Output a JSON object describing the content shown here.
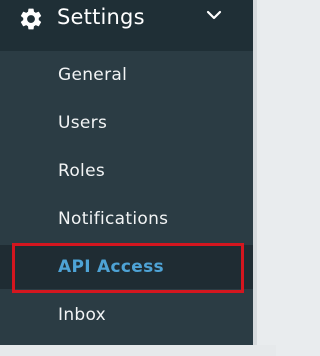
{
  "header": {
    "title": "Settings",
    "icon": "gear-icon",
    "toggle_icon": "chevron-down-icon"
  },
  "menu": {
    "items": [
      {
        "label": "General"
      },
      {
        "label": "Users"
      },
      {
        "label": "Roles"
      },
      {
        "label": "Notifications"
      },
      {
        "label": "API Access",
        "active": true
      },
      {
        "label": "Inbox"
      }
    ]
  },
  "colors": {
    "sidebar_bg": "#2b3c44",
    "header_bg": "#1f2f36",
    "active_text": "#4ea3d6",
    "highlight_border": "#d4161f"
  }
}
